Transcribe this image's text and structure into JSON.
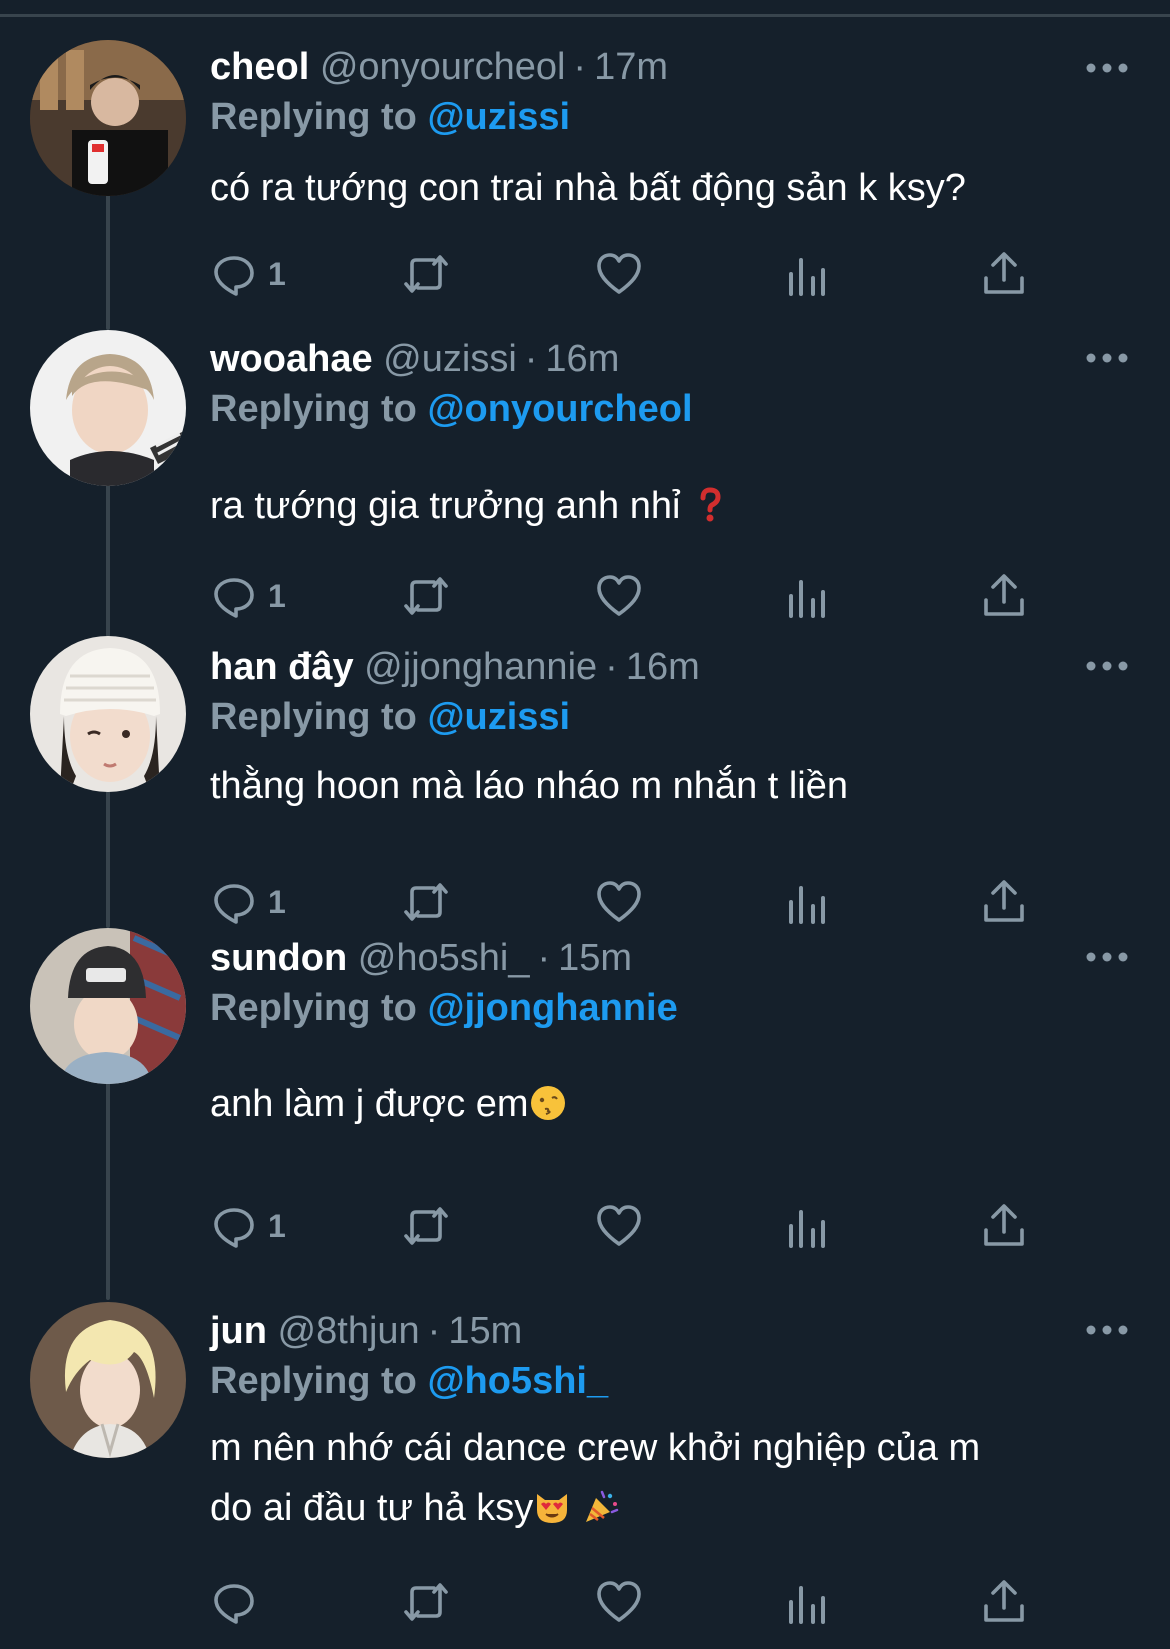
{
  "tweets": [
    {
      "display_name": "cheol",
      "handle": "@onyourcheol",
      "separator": "·",
      "time": "17m",
      "reply_prefix": "Replying to",
      "reply_to": "@uzissi",
      "text": "có ra tướng con trai nhà bất động sản k ksy?",
      "reply_count": "1"
    },
    {
      "display_name": "wooahae",
      "handle": "@uzissi",
      "separator": "·",
      "time": "16m",
      "reply_prefix": "Replying to",
      "reply_to": "@onyourcheol",
      "text": "ra tướng gia trưởng anh nhỉ",
      "emoji": "red-question-mark",
      "reply_count": "1"
    },
    {
      "display_name": "han đây",
      "handle": "@jjonghannie",
      "separator": "·",
      "time": "16m",
      "reply_prefix": "Replying to",
      "reply_to": "@uzissi",
      "text": "thằng hoon mà láo nháo m nhắn t liền",
      "reply_count": "1"
    },
    {
      "display_name": "sundon",
      "handle": "@ho5shi_",
      "separator": "·",
      "time": "15m",
      "reply_prefix": "Replying to",
      "reply_to": "@jjonghannie",
      "text": "anh làm j được em",
      "emoji": "kissing-face",
      "reply_count": "1"
    },
    {
      "display_name": "jun",
      "handle": "@8thjun",
      "separator": "·",
      "time": "15m",
      "reply_prefix": "Replying to",
      "reply_to": "@ho5shi_",
      "text_line1": "m nên nhớ cái dance crew khởi nghiệp của m",
      "text_line2": "do ai đầu tư hả ksy",
      "emoji": "heart-eyes-cat-and-party-popper",
      "reply_count": ""
    }
  ],
  "colors": {
    "background": "#15202b",
    "secondary_text": "#8899a6",
    "accent": "#1d9bf0",
    "thread_line": "#38444d"
  },
  "icons": [
    "reply-icon",
    "retweet-icon",
    "like-icon",
    "views-icon",
    "share-icon",
    "more-icon"
  ]
}
